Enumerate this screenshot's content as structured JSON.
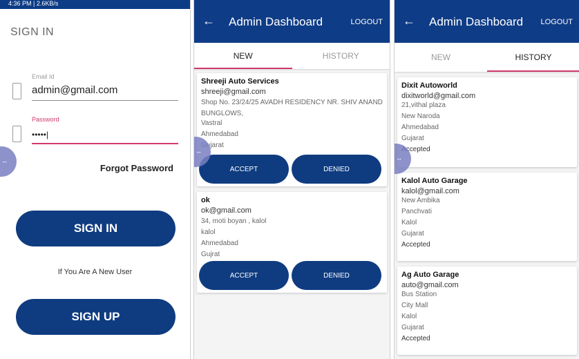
{
  "signin_screen": {
    "status_left": "4:36 PM | 2.6KB/s",
    "status_right": "",
    "title": "SIGN IN",
    "email_label": "Email Id",
    "email_value": "admin@gmail.com",
    "password_label": "Password",
    "password_value": "•••••|",
    "forgot": "Forgot Password",
    "signin_button": "SIGN IN",
    "new_user_text": "If You Are A New User",
    "signup_button": "SIGN UP"
  },
  "dashboard_new": {
    "title": "Admin Dashboard",
    "logout": "LOGOUT",
    "tabs": [
      "NEW",
      "HISTORY"
    ],
    "active_tab": "NEW",
    "cards": [
      {
        "name": "Shreeji Auto Services",
        "email": "shreeji@gmail.com",
        "address": "Shop No. 23/24/25 AVADH RESIDENCY NR. SHIV ANAND BUNGLOWS,",
        "lines": [
          "Vastral",
          "Ahmedabad",
          "Gujarat"
        ],
        "accept": "ACCEPT",
        "deny": "DENIED"
      },
      {
        "name": "ok",
        "email": "ok@gmail.com",
        "address": "34, moti boyan , kalol",
        "lines": [
          "kalol",
          "Ahmedabad",
          "Gujrat"
        ],
        "accept": "ACCEPT",
        "deny": "DENIED"
      }
    ]
  },
  "dashboard_history": {
    "title": "Admin Dashboard",
    "logout": "LOGOUT",
    "tabs": [
      "NEW",
      "HISTORY"
    ],
    "active_tab": "HISTORY",
    "cards": [
      {
        "name": "Dixit Autoworld",
        "email": "dixitworld@gmail.com",
        "lines": [
          "21,vithal plaza",
          "New Naroda",
          "Ahmedabad",
          "Gujarat"
        ],
        "status": "Accepted"
      },
      {
        "name": "Kalol Auto Garage",
        "email": "kalol@gmail.com",
        "lines": [
          "New Ambika",
          "Panchvati",
          "Kalol",
          "Gujarat"
        ],
        "status": "Accepted"
      },
      {
        "name": "Ag Auto Garage",
        "email": "auto@gmail.com",
        "lines": [
          "Bus Station",
          "City Mall",
          "Kalol",
          "Gujarat"
        ],
        "status": "Accepted"
      }
    ]
  },
  "colors": {
    "primary": "#0f3c86",
    "accent": "#d0386c",
    "fab": "#7a7fc2"
  },
  "icons": [
    "back-arrow-icon",
    "phone-icon",
    "fab-icon"
  ]
}
